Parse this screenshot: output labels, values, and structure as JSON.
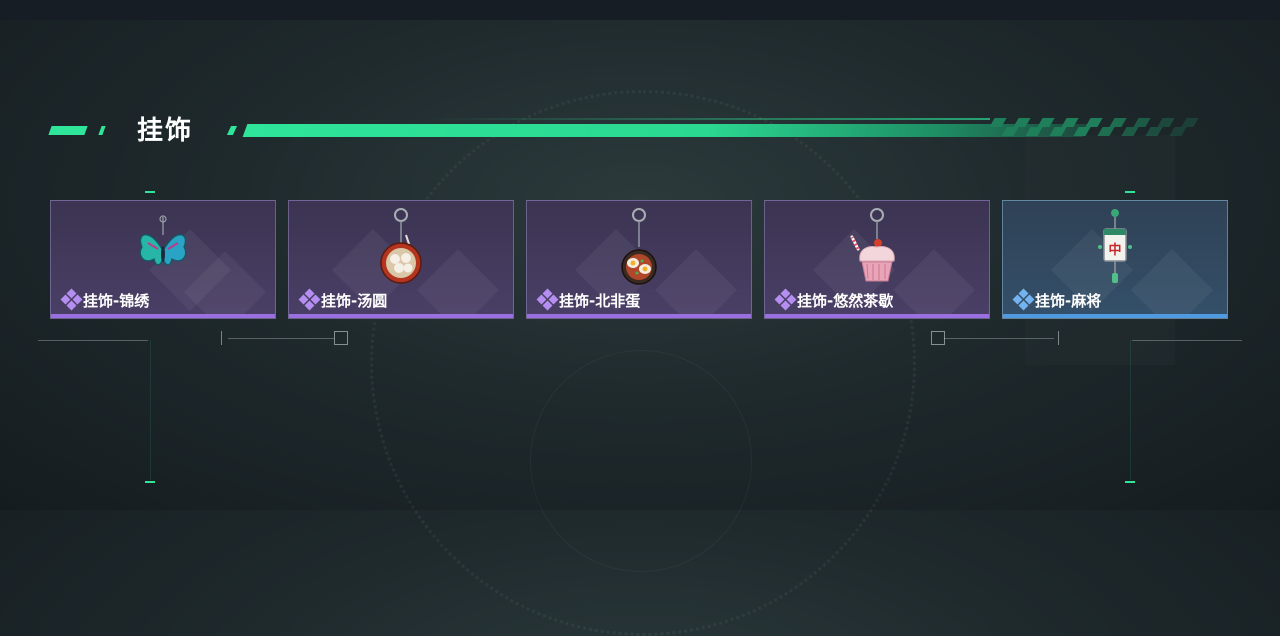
{
  "section": {
    "title": "挂饰"
  },
  "cards": [
    {
      "label": "挂饰-锦绣",
      "icon": "butterfly-charm-icon",
      "rarity": "purple"
    },
    {
      "label": "挂饰-汤圆",
      "icon": "tangyuan-bowl-charm-icon",
      "rarity": "purple"
    },
    {
      "label": "挂饰-北非蛋",
      "icon": "shakshuka-pan-charm-icon",
      "rarity": "purple"
    },
    {
      "label": "挂饰-悠然茶歇",
      "icon": "cupcake-charm-icon",
      "rarity": "purple"
    },
    {
      "label": "挂饰-麻将",
      "icon": "mahjong-tile-charm-icon",
      "rarity": "blue"
    }
  ],
  "colors": {
    "accent": "#2ee59a",
    "rarity_purple": "#9a6fe0",
    "rarity_blue": "#4f9ae0"
  }
}
